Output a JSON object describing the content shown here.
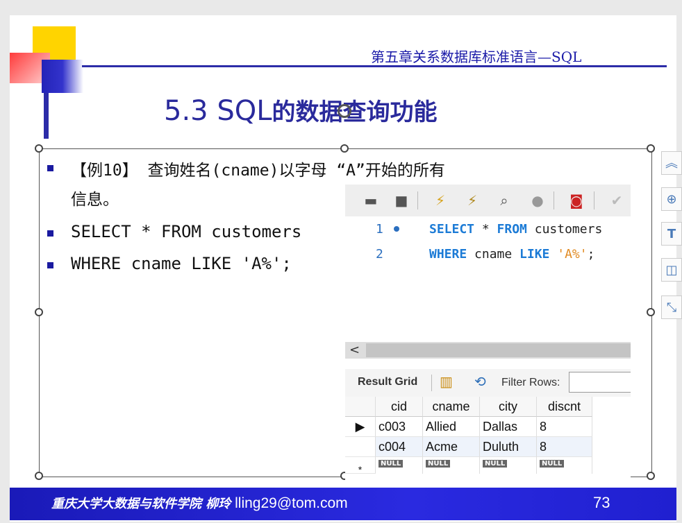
{
  "header": {
    "chapter": "第五章关系数据库标准语言—SQL"
  },
  "title": {
    "prefix": "5.3 SQL",
    "suffix": "的数据查询功能"
  },
  "bullets": {
    "b1_line1": "【例10】 查询姓名(cname)以字母 “A”开始的所有",
    "b1_line2": "信息。",
    "b2": "SELECT * FROM customers",
    "b3": "WHERE cname LIKE 'A%';"
  },
  "workbench": {
    "toolbar_icons": [
      "folder-icon",
      "save-icon",
      "execute-icon",
      "execute-current-icon",
      "explain-icon",
      "stop-icon",
      "toggle-error-icon",
      "commit-icon"
    ],
    "editor": {
      "lines": [
        {
          "number": "1",
          "kw1": "SELECT",
          "mid1": " * ",
          "kw2": "FROM",
          "rest": " customers"
        },
        {
          "number": "2",
          "kw1": "WHERE",
          "mid1": " cname ",
          "kw2": "LIKE",
          "str": " 'A%'",
          "end": ";"
        }
      ]
    },
    "result": {
      "title": "Result Grid",
      "filter_label": "Filter Rows:",
      "columns": [
        "cid",
        "cname",
        "city",
        "discnt"
      ],
      "rows": [
        [
          "c003",
          "Allied",
          "Dallas",
          "8"
        ],
        [
          "c004",
          "Acme",
          "Duluth",
          "8"
        ]
      ],
      "null_label": "NULL",
      "new_row_marker": "*"
    }
  },
  "footer": {
    "school": "重庆大学大数据与软件学院 柳玲",
    "email": "lling29@tom.com",
    "page": "73"
  },
  "colors": {
    "title": "#2a2a9c",
    "footer_bg": "#1a1ab8",
    "keyword": "#1c7bd6",
    "string": "#e08a22"
  }
}
